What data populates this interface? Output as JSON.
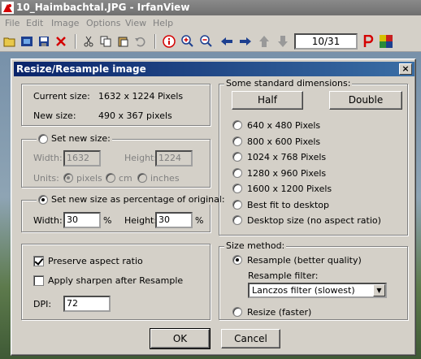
{
  "window": {
    "title": "10_Haimbachtal.JPG - IrfanView",
    "menu": [
      "File",
      "Edit",
      "Image",
      "Options",
      "View",
      "Help"
    ],
    "page_counter": "10/31"
  },
  "dialog": {
    "title": "Resize/Resample image",
    "close_label": "×",
    "info": {
      "current_label": "Current size:",
      "current_value": "1632  x  1224  Pixels",
      "new_label": "New size:",
      "new_value": "490  x  367  pixels"
    },
    "set_new_size": {
      "label": "Set new size:",
      "width_label": "Width:",
      "width_value": "1632",
      "height_label": "Height:",
      "height_value": "1224",
      "units_label": "Units:",
      "units": [
        "pixels",
        "cm",
        "inches"
      ]
    },
    "percentage": {
      "label": "Set new size as percentage of original:",
      "width_label": "Width:",
      "width_value": "30",
      "height_label": "Height:",
      "height_value": "30",
      "unit": "%"
    },
    "options": {
      "preserve_label": "Preserve aspect ratio",
      "sharpen_label": "Apply sharpen after Resample",
      "dpi_label": "DPI:",
      "dpi_value": "72"
    },
    "standard": {
      "legend": "Some standard dimensions:",
      "half_label": "Half",
      "double_label": "Double",
      "items": [
        "640 x 480 Pixels",
        "800 x 600 Pixels",
        "1024 x 768 Pixels",
        "1280 x 960 Pixels",
        "1600 x 1200 Pixels",
        "Best fit to desktop",
        "Desktop size (no aspect ratio)"
      ]
    },
    "method": {
      "legend": "Size method:",
      "resample_label": "Resample (better quality)",
      "filter_label": "Resample filter:",
      "filter_value": "Lanczos filter (slowest)",
      "resize_label": "Resize (faster)"
    },
    "ok_label": "OK",
    "cancel_label": "Cancel"
  }
}
